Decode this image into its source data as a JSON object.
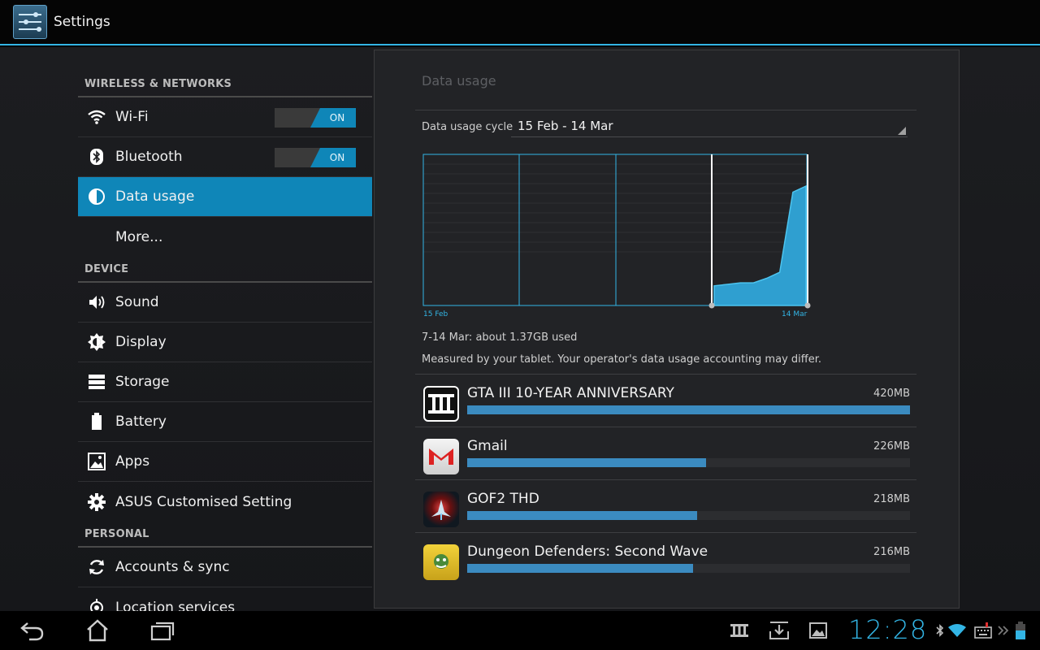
{
  "actionbar": {
    "title": "Settings"
  },
  "sidebar": {
    "sections": [
      {
        "header": "WIRELESS & NETWORKS"
      },
      {
        "header": "DEVICE"
      },
      {
        "header": "PERSONAL"
      }
    ],
    "wifi": {
      "label": "Wi-Fi",
      "toggle": "ON",
      "icon": "wifi-icon"
    },
    "bluetooth": {
      "label": "Bluetooth",
      "toggle": "ON",
      "icon": "bluetooth-icon"
    },
    "data_usage": {
      "label": "Data usage",
      "icon": "data-usage-icon"
    },
    "more": {
      "label": "More..."
    },
    "sound": {
      "label": "Sound",
      "icon": "speaker-icon"
    },
    "display": {
      "label": "Display",
      "icon": "brightness-icon"
    },
    "storage": {
      "label": "Storage",
      "icon": "storage-icon"
    },
    "battery": {
      "label": "Battery",
      "icon": "battery-icon"
    },
    "apps": {
      "label": "Apps",
      "icon": "apps-icon"
    },
    "asus": {
      "label": "ASUS Customised Setting",
      "icon": "gear-icon"
    },
    "accounts": {
      "label": "Accounts & sync",
      "icon": "sync-icon"
    },
    "location": {
      "label": "Location services",
      "icon": "location-icon"
    }
  },
  "detail": {
    "title": "Data usage",
    "cycle_label": "Data usage cycle",
    "cycle_value": "15 Feb - 14 Mar",
    "summary": "7-14 Mar: about 1.37GB used",
    "note": "Measured by your tablet. Your operator's data usage accounting may differ.",
    "apps": [
      {
        "name": "GTA III 10-YEAR ANNIVERSARY",
        "size": "420MB",
        "fraction": 1.0
      },
      {
        "name": "Gmail",
        "size": "226MB",
        "fraction": 0.54
      },
      {
        "name": "GOF2 THD",
        "size": "218MB",
        "fraction": 0.52
      },
      {
        "name": "Dungeon Defenders: Second Wave",
        "size": "216MB",
        "fraction": 0.51
      }
    ]
  },
  "chart_data": {
    "type": "area",
    "x_start_label": "15 Feb",
    "x_end_label": "14 Mar",
    "x": [
      "7 Mar",
      "8 Mar",
      "9 Mar",
      "10 Mar",
      "11 Mar",
      "12 Mar",
      "13 Mar",
      "14 Mar"
    ],
    "values": [
      0.13,
      0.14,
      0.15,
      0.15,
      0.18,
      0.22,
      0.75,
      0.79
    ],
    "ylim": [
      0,
      1
    ],
    "selection": [
      "7 Mar",
      "14 Mar"
    ],
    "colors": {
      "fill": "#33a7d6",
      "line": "#33b5e5",
      "grid": "#2e2f33"
    }
  },
  "statusbar": {
    "clock": "12:28",
    "colors": {
      "accent": "#33b5e5"
    }
  }
}
